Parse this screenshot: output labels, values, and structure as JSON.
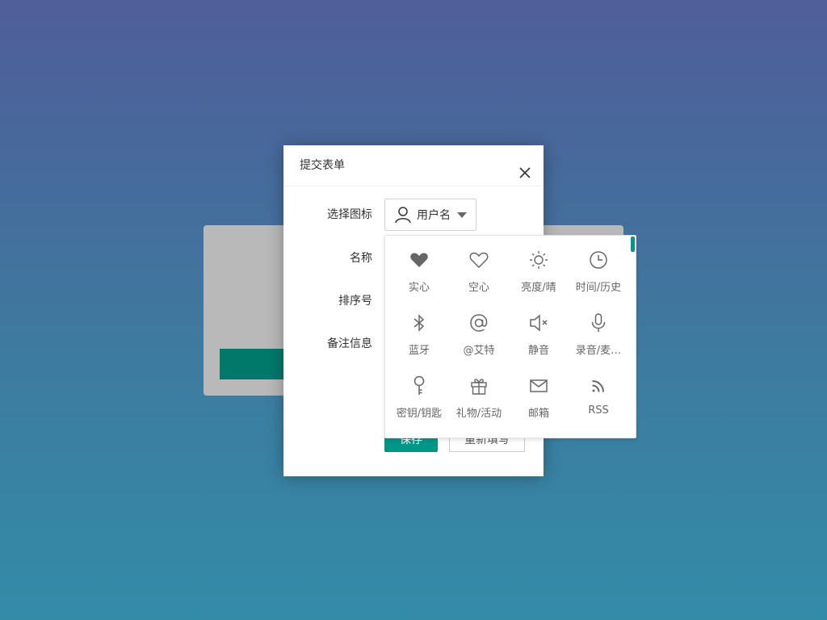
{
  "modal": {
    "title": "提交表单",
    "fields": {
      "icon_label": "选择图标",
      "name_label": "名称",
      "order_label": "排序号",
      "remark_label": "备注信息"
    },
    "icon_select": {
      "selected": "用户名",
      "icon": "user-icon"
    },
    "buttons": {
      "save": "保存",
      "reset": "重新填写"
    }
  },
  "icon_panel": {
    "accent_color": "#009688",
    "items": [
      {
        "label": "实心",
        "icon": "heart-filled-icon"
      },
      {
        "label": "空心",
        "icon": "heart-outline-icon"
      },
      {
        "label": "亮度/晴",
        "icon": "sun-icon"
      },
      {
        "label": "时间/历史",
        "icon": "clock-icon"
      },
      {
        "label": "蓝牙",
        "icon": "bluetooth-icon"
      },
      {
        "label": "@艾特",
        "icon": "at-icon"
      },
      {
        "label": "静音",
        "icon": "mute-icon"
      },
      {
        "label": "录音/麦…",
        "icon": "microphone-icon"
      },
      {
        "label": "密钥/钥匙",
        "icon": "key-icon"
      },
      {
        "label": "礼物/活动",
        "icon": "gift-icon"
      },
      {
        "label": "邮箱",
        "icon": "mail-icon"
      },
      {
        "label": "RSS",
        "icon": "rss-icon"
      }
    ]
  },
  "colors": {
    "primary": "#009688",
    "background_top": "#505e9a",
    "background_bottom": "#338ba8"
  }
}
